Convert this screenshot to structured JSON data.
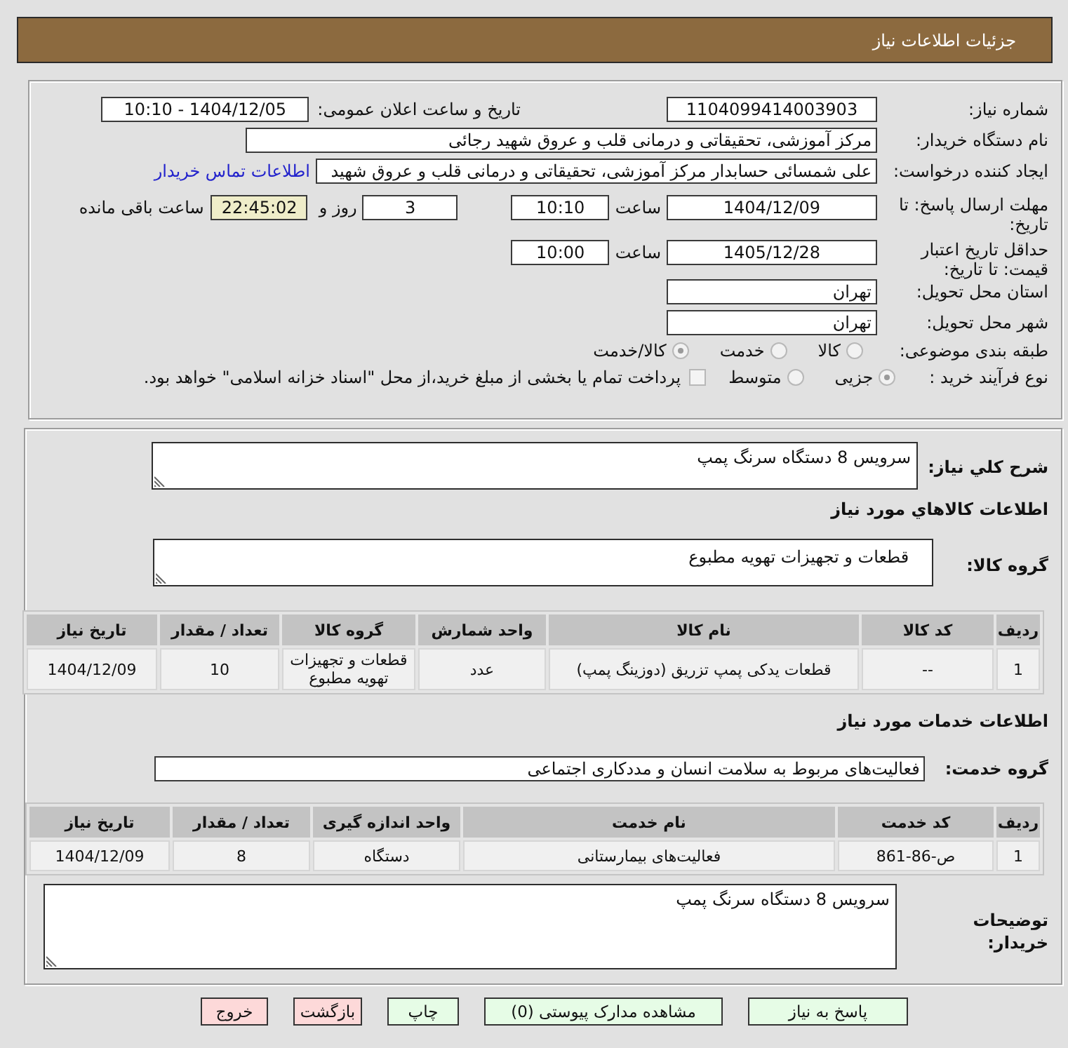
{
  "header": {
    "title": "جزئیات اطلاعات نیاز"
  },
  "need_number": {
    "label": "شماره نیاز:",
    "value": "1104099414003903"
  },
  "announcement": {
    "label": "تاریخ و ساعت اعلان عمومی:",
    "value": "1404/12/05 - 10:10"
  },
  "buyer_org": {
    "label": "نام دستگاه خریدار:",
    "value": "مرکز آموزشی، تحقیقاتی و درمانی قلب و عروق شهید رجائی"
  },
  "requester": {
    "label": "ایجاد کننده درخواست:",
    "value": "علی شمسائی حسابدار مرکز آموزشی، تحقیقاتی و درمانی قلب و عروق شهید",
    "contact_link": "اطلاعات تماس خریدار"
  },
  "response_deadline": {
    "label": "مهلت ارسال پاسخ: تا تاریخ:",
    "date": "1404/12/09",
    "time_label": "ساعت",
    "time": "10:10",
    "days": "3",
    "days_label": "روز و",
    "remaining": "22:45:02",
    "remaining_label": "ساعت باقی مانده"
  },
  "price_validity": {
    "label": "حداقل تاریخ اعتبار قیمت: تا تاریخ:",
    "date": "1405/12/28",
    "time_label": "ساعت",
    "time": "10:00"
  },
  "province": {
    "label": "استان محل تحویل:",
    "value": "تهران"
  },
  "city": {
    "label": "شهر محل تحویل:",
    "value": "تهران"
  },
  "category": {
    "label": "طبقه بندی موضوعی:",
    "options": [
      {
        "label": "کالا",
        "selected": false
      },
      {
        "label": "خدمت",
        "selected": false
      },
      {
        "label": "کالا/خدمت",
        "selected": true
      }
    ]
  },
  "purchase_type": {
    "label": "نوع فرآیند خرید :",
    "options": [
      {
        "label": "جزیی",
        "selected": true
      },
      {
        "label": "متوسط",
        "selected": false
      }
    ],
    "treasury_option": {
      "label": "پرداخت تمام یا بخشی از مبلغ خرید،از محل \"اسناد خزانه اسلامی\" خواهد بود.",
      "checked": false
    }
  },
  "summary": {
    "label": "شرح کلي نیاز:",
    "value": "سرویس 8 دستگاه سرنگ پمپ"
  },
  "goods": {
    "heading": "اطلاعات کالاهاي مورد نیاز",
    "group_label": "گروه کالا:",
    "group_value": "قطعات و تجهیزات تهویه مطبوع",
    "table": {
      "columns": [
        "ردیف",
        "کد کالا",
        "نام کالا",
        "واحد شمارش",
        "گروه کالا",
        "تعداد / مقدار",
        "تاریخ نیاز"
      ],
      "rows": [
        [
          "1",
          "--",
          "قطعات یدکی پمپ تزریق (دوزینگ پمپ)",
          "عدد",
          "قطعات و تجهیزات تهویه مطبوع",
          "10",
          "1404/12/09"
        ]
      ]
    }
  },
  "services": {
    "heading": "اطلاعات خدمات مورد نیاز",
    "group_label": "گروه خدمت:",
    "group_value": "فعالیت‌های مربوط به سلامت انسان و مددکاری اجتماعی",
    "table": {
      "columns": [
        "ردیف",
        "کد خدمت",
        "نام خدمت",
        "واحد اندازه گیری",
        "تعداد / مقدار",
        "تاریخ نیاز"
      ],
      "rows": [
        [
          "1",
          "ص-86-861",
          "فعالیت‌های بیمارستانی",
          "دستگاه",
          "8",
          "1404/12/09"
        ]
      ]
    }
  },
  "buyer_notes": {
    "label": "توضیحات خریدار:",
    "value": "سرویس 8 دستگاه سرنگ پمپ"
  },
  "buttons": [
    {
      "label": "پاسخ به نیاز",
      "kind": "action"
    },
    {
      "label": "مشاهده مدارک پیوستی (0)",
      "kind": "action"
    },
    {
      "label": "چاپ",
      "kind": "action"
    },
    {
      "label": "بازگشت",
      "kind": "exit"
    },
    {
      "label": "خروج",
      "kind": "exit"
    }
  ]
}
